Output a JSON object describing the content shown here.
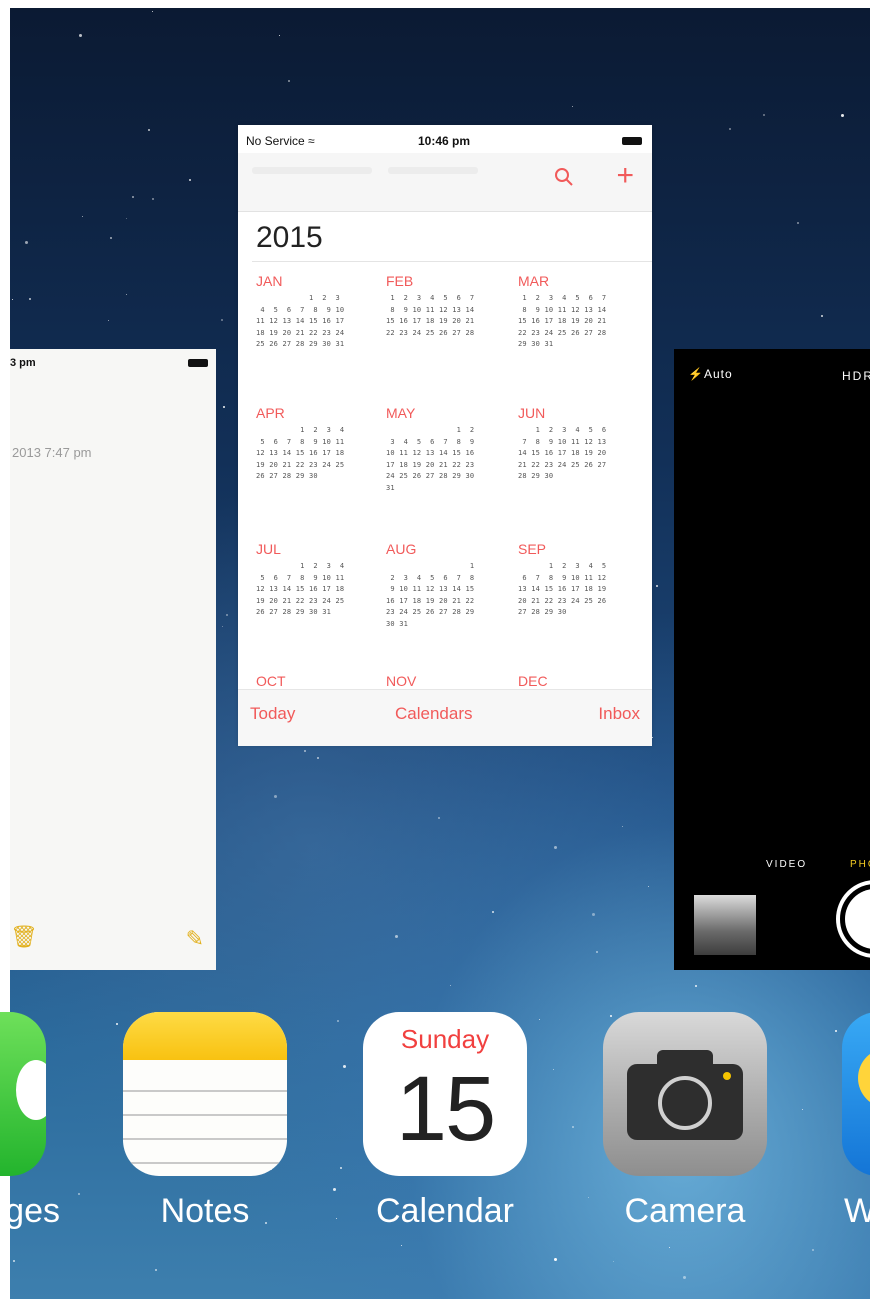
{
  "notes_card": {
    "status_time": "3 pm",
    "date_text": "2013 7:47 pm"
  },
  "calendar_card": {
    "status": {
      "service": "No Service",
      "wifi": "wifi-icon",
      "time": "10:46 pm"
    },
    "year": "2015",
    "months": [
      {
        "name": "JAN",
        "weeks": [
          "            1  2  3",
          " 4  5  6  7  8  9 10",
          "11 12 13 14 15 16 17",
          "18 19 20 21 22 23 24",
          "25 26 27 28 29 30 31"
        ]
      },
      {
        "name": "FEB",
        "weeks": [
          " 1  2  3  4  5  6  7",
          " 8  9 10 11 12 13 14",
          "15 16 17 18 19 20 21",
          "22 23 24 25 26 27 28"
        ]
      },
      {
        "name": "MAR",
        "weeks": [
          " 1  2  3  4  5  6  7",
          " 8  9 10 11 12 13 14",
          "15 16 17 18 19 20 21",
          "22 23 24 25 26 27 28",
          "29 30 31"
        ]
      },
      {
        "name": "APR",
        "weeks": [
          "          1  2  3  4",
          " 5  6  7  8  9 10 11",
          "12 13 14 15 16 17 18",
          "19 20 21 22 23 24 25",
          "26 27 28 29 30"
        ]
      },
      {
        "name": "MAY",
        "weeks": [
          "                1  2",
          " 3  4  5  6  7  8  9",
          "10 11 12 13 14 15 16",
          "17 18 19 20 21 22 23",
          "24 25 26 27 28 29 30",
          "31"
        ]
      },
      {
        "name": "JUN",
        "weeks": [
          "    1  2  3  4  5  6",
          " 7  8  9 10 11 12 13",
          "14 15 16 17 18 19 20",
          "21 22 23 24 25 26 27",
          "28 29 30"
        ]
      },
      {
        "name": "JUL",
        "weeks": [
          "          1  2  3  4",
          " 5  6  7  8  9 10 11",
          "12 13 14 15 16 17 18",
          "19 20 21 22 23 24 25",
          "26 27 28 29 30 31"
        ]
      },
      {
        "name": "AUG",
        "weeks": [
          "                   1",
          " 2  3  4  5  6  7  8",
          " 9 10 11 12 13 14 15",
          "16 17 18 19 20 21 22",
          "23 24 25 26 27 28 29",
          "30 31"
        ]
      },
      {
        "name": "SEP",
        "weeks": [
          "       1  2  3  4  5",
          " 6  7  8  9 10 11 12",
          "13 14 15 16 17 18 19",
          "20 21 22 23 24 25 26",
          "27 28 29 30"
        ]
      },
      {
        "name": "OCT",
        "weeks": []
      },
      {
        "name": "NOV",
        "weeks": []
      },
      {
        "name": "DEC",
        "weeks": []
      }
    ],
    "toolbar": {
      "today": "Today",
      "calendars": "Calendars",
      "inbox": "Inbox"
    }
  },
  "camera_card": {
    "flash": "Auto",
    "hdr": "HDR",
    "mode_video": "VIDEO",
    "mode_photo": "PHOTO"
  },
  "dock": {
    "messages_label": "Messages",
    "notes_label": "Notes",
    "calendar_label": "Calendar",
    "calendar_day": "Sunday",
    "calendar_date": "15",
    "camera_label": "Camera",
    "weather_label": "Weather"
  },
  "colors": {
    "accent_red": "#f15a5a",
    "notes_yellow": "#e2b11f",
    "camera_photo_yellow": "#f5cc22"
  }
}
